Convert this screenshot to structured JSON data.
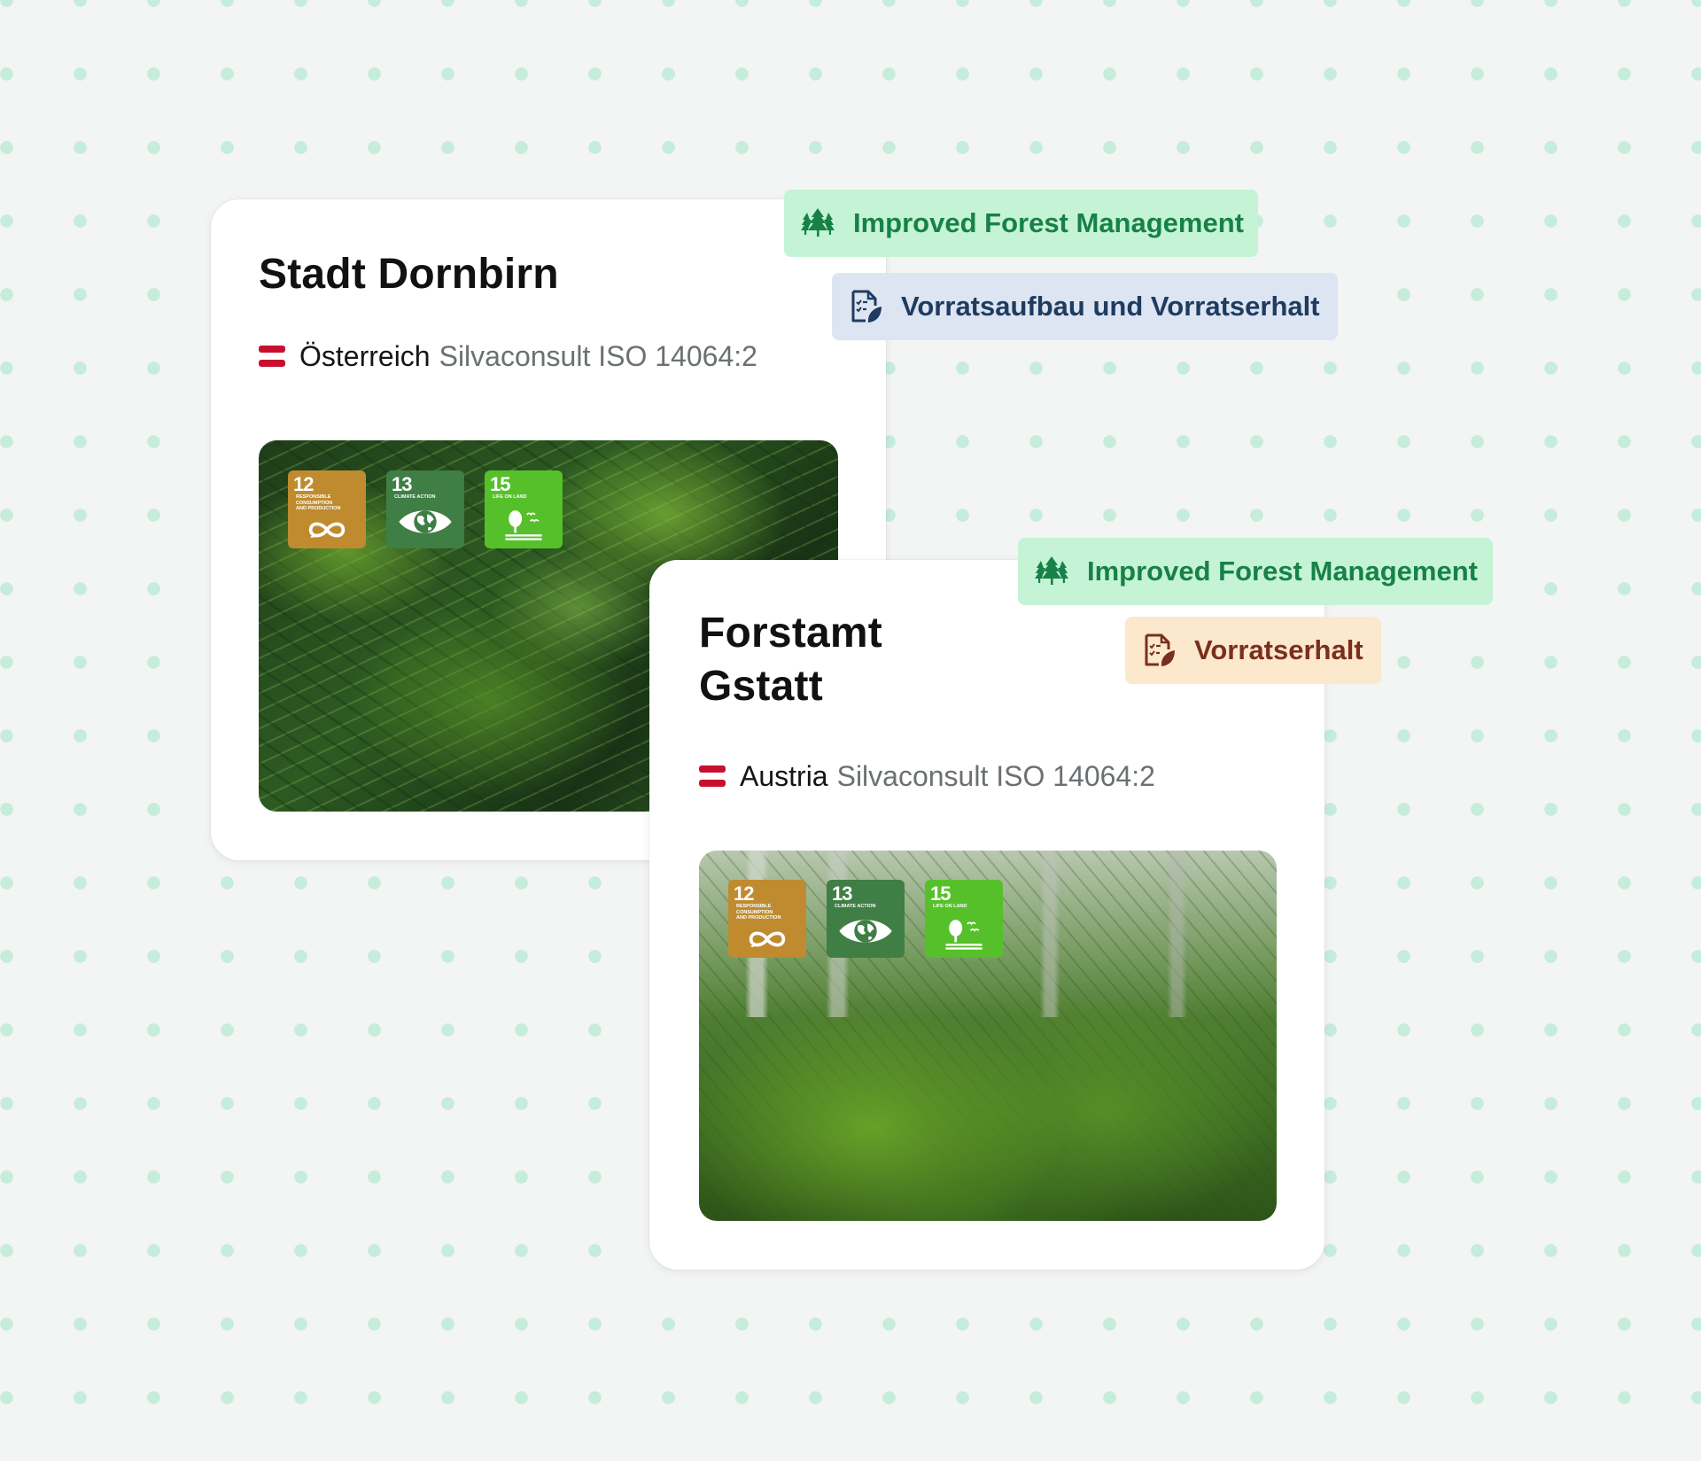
{
  "colors": {
    "background": "#f3f4f4",
    "dot": "#c6ecdb",
    "card": "#ffffff",
    "flag_red": "#c8102e",
    "badge_green_bg": "#c4f3d5",
    "badge_green_text": "#178147",
    "badge_blue_bg": "#dce5f1",
    "badge_blue_text": "#1f3b60",
    "badge_orange_bg": "#fbe8cd",
    "badge_orange_text": "#7a2f1d",
    "sdg12": "#bf8b2e",
    "sdg13": "#3f7e44",
    "sdg15": "#56c02b"
  },
  "projects": [
    {
      "title": "Stadt Dornbirn",
      "flag_icon": "austria-flag-icon",
      "country": "Österreich",
      "certification": "Silvaconsult ISO 14064:2",
      "photo": "forest-closeup-fir-branches",
      "sdgs": [
        {
          "number": "12",
          "label": "Responsible Consumption and Production",
          "icon": "infinity-icon"
        },
        {
          "number": "13",
          "label": "Climate Action",
          "icon": "eye-globe-icon"
        },
        {
          "number": "15",
          "label": "Life on Land",
          "icon": "tree-birds-icon"
        }
      ],
      "badges": [
        {
          "label": "Improved Forest Management",
          "icon": "forest-trees-icon",
          "variant": "green"
        },
        {
          "label": "Vorratsaufbau und Vorratserhalt",
          "icon": "checklist-leaf-icon",
          "variant": "blue"
        }
      ]
    },
    {
      "title": "Forstamt Gstatt",
      "flag_icon": "austria-flag-icon",
      "country": "Austria",
      "certification": "Silvaconsult ISO 14064:2",
      "photo": "forest-undergrowth-young-trees",
      "sdgs": [
        {
          "number": "12",
          "label": "Responsible Consumption and Production",
          "icon": "infinity-icon"
        },
        {
          "number": "13",
          "label": "Climate Action",
          "icon": "eye-globe-icon"
        },
        {
          "number": "15",
          "label": "Life on Land",
          "icon": "tree-birds-icon"
        }
      ],
      "badges": [
        {
          "label": "Improved Forest Management",
          "icon": "forest-trees-icon",
          "variant": "green"
        },
        {
          "label": "Vorratserhalt",
          "icon": "checklist-leaf-icon",
          "variant": "orange"
        }
      ]
    }
  ]
}
